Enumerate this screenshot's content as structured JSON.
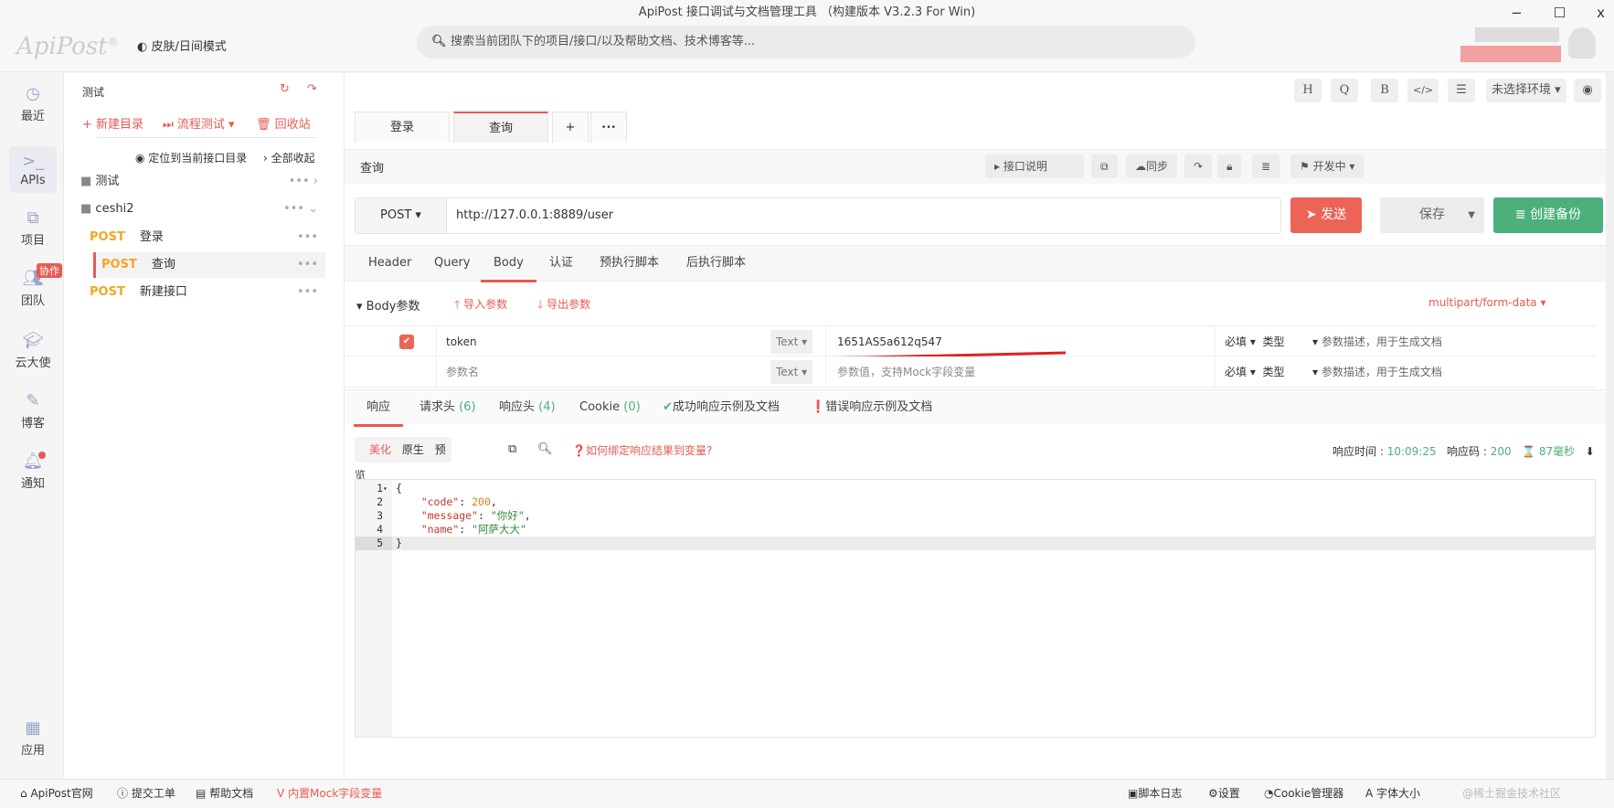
{
  "window": {
    "title": "ApiPost 接口调试与文档管理工具 （构建版本 V3.2.3 For Win)",
    "minimize": "−",
    "maximize": "☐",
    "close": "x"
  },
  "header": {
    "logo": "ApiPost",
    "skin_mode": "皮肤/日间模式",
    "search_placeholder": "搜索当前团队下的项目/接口/以及帮助文档、技术博客等..."
  },
  "rail": [
    {
      "label": "最近",
      "icon": "clock-icon"
    },
    {
      "label": "APIs",
      "icon": "terminal-icon"
    },
    {
      "label": "项目",
      "icon": "project-icon"
    },
    {
      "label": "团队",
      "icon": "team-icon",
      "badge": "协作"
    },
    {
      "label": "云大使",
      "icon": "graduation-cap-icon"
    },
    {
      "label": "博客",
      "icon": "edit-icon"
    },
    {
      "label": "通知",
      "icon": "bell-icon"
    },
    {
      "label": "应用",
      "icon": "apps-icon"
    }
  ],
  "tree": {
    "title": "测试",
    "new_folder": "+ 新建目录",
    "flow_test": "流程测试",
    "recycle": "回收站",
    "locate": "定位到当前接口目录",
    "collapse_all": "全部收起",
    "folders": [
      {
        "name": "测试"
      },
      {
        "name": "ceshi2"
      }
    ],
    "apis": [
      {
        "method": "POST",
        "name": "登录"
      },
      {
        "method": "POST",
        "name": "查询"
      },
      {
        "method": "POST",
        "name": "新建接口"
      }
    ]
  },
  "toolbar": {
    "h": "H",
    "q": "Q",
    "b": "B",
    "code": "</>",
    "settings": "⚙",
    "env": "未选择环境"
  },
  "tabs": [
    {
      "label": "登录"
    },
    {
      "label": "查询"
    }
  ],
  "tab_add": "+",
  "tab_more": "•••",
  "sub": {
    "title": "查询",
    "doc": "接口说明",
    "sync": "同步",
    "status": "开发中"
  },
  "request": {
    "method": "POST",
    "url": "http://127.0.0.1:8889/user",
    "send": "发送",
    "save": "保存",
    "backup": "创建备份"
  },
  "req_tabs": [
    "Header",
    "Query",
    "Body",
    "认证",
    "预执行脚本",
    "后执行脚本"
  ],
  "body": {
    "section": "Body参数",
    "import": "导入参数",
    "export": "导出参数",
    "content_type": "multipart/form-data",
    "rows": [
      {
        "checked": true,
        "key": "token",
        "type": "Text",
        "value": "1651AS5a612q547",
        "required": "必填",
        "dtype": "类型",
        "desc": "参数描述，用于生成文档"
      },
      {
        "checked": false,
        "key_placeholder": "参数名",
        "type": "Text",
        "value_placeholder": "参数值，支持Mock字段变量",
        "required": "必填",
        "dtype": "类型",
        "desc": "参数描述，用于生成文档"
      }
    ]
  },
  "resp_tabs": [
    {
      "label": "响应"
    },
    {
      "label": "请求头",
      "count": "(6)"
    },
    {
      "label": "响应头",
      "count": "(4)"
    },
    {
      "label": "Cookie",
      "count": "(0)"
    },
    {
      "label": "成功响应示例及文档"
    },
    {
      "label": "错误响应示例及文档"
    }
  ],
  "resp": {
    "modes": [
      "美化",
      "原生",
      "预览"
    ],
    "help": "如何绑定响应结果到变量?",
    "time_label": "响应时间 :",
    "time": "10:09:25",
    "code_label": "响应码 :",
    "code": "200",
    "duration": "87毫秒"
  },
  "code_lines": [
    {
      "n": "1",
      "t": "{"
    },
    {
      "n": "2",
      "k": "\"code\"",
      "v": "200",
      "vt": "n",
      "tail": ","
    },
    {
      "n": "3",
      "k": "\"message\"",
      "v": "\"你好\"",
      "vt": "s",
      "tail": ","
    },
    {
      "n": "4",
      "k": "\"name\"",
      "v": "\"阿萨大大\"",
      "vt": "s",
      "tail": ""
    },
    {
      "n": "5",
      "t": "}"
    }
  ],
  "footer": {
    "site": "ApiPost官网",
    "ticket": "提交工单",
    "help": "帮助文档",
    "mock": "内置Mock字段变量",
    "log": "脚本日志",
    "settings": "设置",
    "cookie": "Cookie管理器",
    "font": "字体大小",
    "watermark": "@稀土掘金技术社区"
  },
  "colors": {
    "accent": "#e85a51",
    "green": "#4cb07a",
    "post": "#f5a623"
  }
}
